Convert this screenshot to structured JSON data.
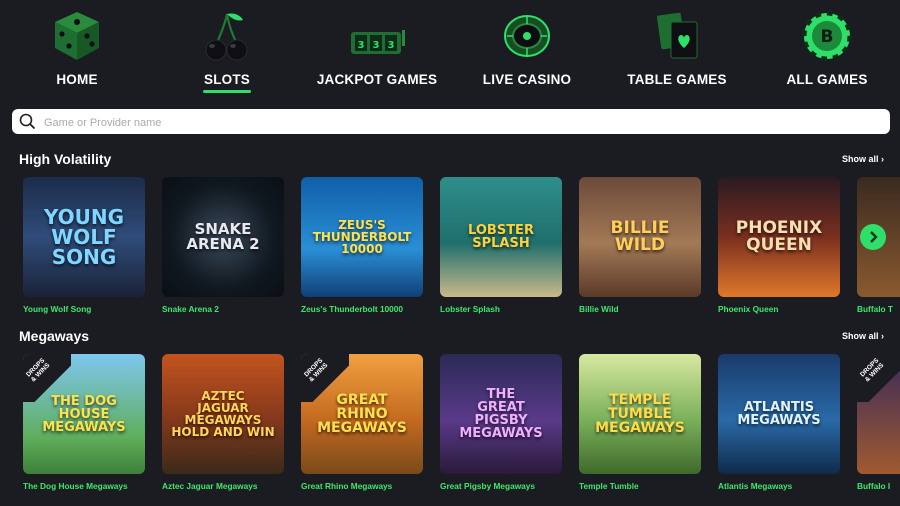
{
  "nav": {
    "items": [
      {
        "label": "HOME",
        "icon": "dice-icon"
      },
      {
        "label": "SLOTS",
        "icon": "cherries-icon",
        "active": true
      },
      {
        "label": "JACKPOT GAMES",
        "icon": "slot-reels-icon"
      },
      {
        "label": "LIVE CASINO",
        "icon": "roulette-wheel-icon"
      },
      {
        "label": "TABLE GAMES",
        "icon": "playing-cards-icon"
      },
      {
        "label": "ALL GAMES",
        "icon": "poker-chip-icon"
      }
    ],
    "accent": "#2ee06a"
  },
  "search": {
    "placeholder": "Game or Provider name",
    "value": ""
  },
  "sections": [
    {
      "title": "High Volatility",
      "show_all": "Show all ›",
      "games": [
        {
          "name": "Young Wolf Song",
          "art": "YOUNG\nWOLF\nSONG"
        },
        {
          "name": "Snake Arena 2",
          "art": "SNAKE\nARENA 2"
        },
        {
          "name": "Zeus's Thunderbolt 10000",
          "art": "ZEUS'S\nTHUNDERBOLT\n10000"
        },
        {
          "name": "Lobster Splash",
          "art": "LOBSTER\nSPLASH"
        },
        {
          "name": "Billie Wild",
          "art": "BILLIE\nWILD"
        },
        {
          "name": "Phoenix Queen",
          "art": "PHOENIX\nQUEEN"
        },
        {
          "name": "Buffalo T",
          "art": ""
        }
      ]
    },
    {
      "title": "Megaways",
      "show_all": "Show all ›",
      "games": [
        {
          "name": "The Dog House Megaways",
          "art": "THE DOG\nHOUSE\nMEGAWAYS",
          "badge": "DROPS\n& WINS"
        },
        {
          "name": "Aztec Jaguar Megaways",
          "art": "AZTEC\nJAGUAR\nMEGAWAYS\nHOLD AND WIN"
        },
        {
          "name": "Great Rhino Megaways",
          "art": "GREAT\nRHINO\nMEGAWAYS",
          "badge": "DROPS\n& WINS"
        },
        {
          "name": "Great Pigsby Megaways",
          "art": "THE\nGREAT\nPIGSBY\nMEGAWAYS"
        },
        {
          "name": "Temple Tumble",
          "art": "TEMPLE\nTUMBLE\nMEGAWAYS"
        },
        {
          "name": "Atlantis Megaways",
          "art": "ATLANTIS\nMEGAWAYS"
        },
        {
          "name": "Buffalo I",
          "art": "",
          "badge": "DROPS\n& WINS"
        }
      ]
    }
  ],
  "colors": {
    "background": "#1b1b22",
    "game_name": "#3ee86c",
    "arrow_button": "#2ee06a"
  }
}
